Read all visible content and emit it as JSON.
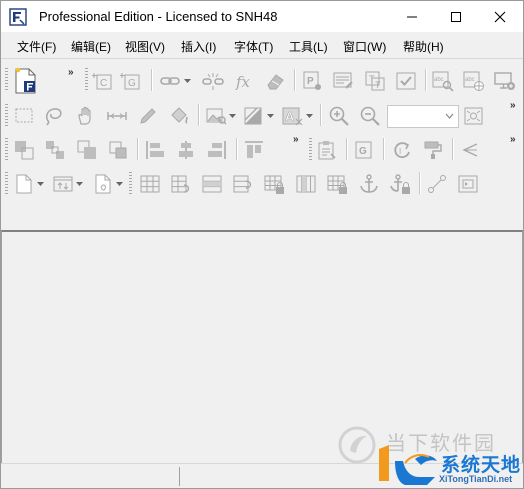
{
  "window": {
    "title": "Professional Edition - Licensed to SNH48",
    "controls": [
      "minimize",
      "maximize",
      "close"
    ]
  },
  "menu": [
    {
      "label": "文件(F)"
    },
    {
      "label": "编辑(E)"
    },
    {
      "label": "视图(V)"
    },
    {
      "label": "插入(I)"
    },
    {
      "label": "字体(T)"
    },
    {
      "label": "工具(L)"
    },
    {
      "label": "窗口(W)"
    },
    {
      "label": "帮助(H)"
    }
  ],
  "toolbar": {
    "zoom_combo_value": "",
    "overflow_glyph": "»"
  },
  "icons": {
    "row1": [
      "new-form-icon",
      "add-text-cell-icon",
      "add-graphic-cell-icon",
      "link-icon",
      "unlink-icon",
      "formula-icon",
      "eraser-icon",
      "field-properties-icon",
      "form-properties-icon",
      "text-properties-icon",
      "check-icon",
      "text-search-icon",
      "text-web-icon",
      "computer-add-icon"
    ],
    "row2": [
      "select-rect-icon",
      "lasso-icon",
      "hand-icon",
      "measure-icon",
      "pencil-icon",
      "fill-bucket-icon",
      "image-icon",
      "line-style-icon",
      "font-style-icon",
      "zoom-in-icon",
      "zoom-out-icon",
      "zoom-fit-icon"
    ],
    "row3": [
      "bring-front-icon",
      "group-icon",
      "send-back-icon",
      "ungroup-icon",
      "align-left-icon",
      "align-center-icon",
      "align-right-icon",
      "align-top-icon",
      "clipboard-icon",
      "graphic-cell-icon",
      "rotate-icon",
      "paint-roller-icon",
      "arrow-left-icon"
    ],
    "row4": [
      "page-icon",
      "tab-order-icon",
      "page-setup-icon",
      "table-grid-icon",
      "table-insert-icon",
      "table-rows-icon",
      "table-split-icon",
      "table-lock-icon",
      "table-columns-icon",
      "table-lock-2-icon",
      "anchor-icon",
      "anchor-lock-icon",
      "connector-icon",
      "field-box-icon"
    ]
  },
  "statusbar": {
    "left_text": ""
  },
  "watermark": {
    "site_text": "当下软件园",
    "brand_cn": "系统天地",
    "brand_en": "XiTongTianDi.net"
  },
  "colors": {
    "toolbar_bg": "#f0f0f0",
    "disabled_icon": "#a9a9a9",
    "brand_blue": "#1a78d2",
    "brand_orange": "#f29a1e"
  }
}
